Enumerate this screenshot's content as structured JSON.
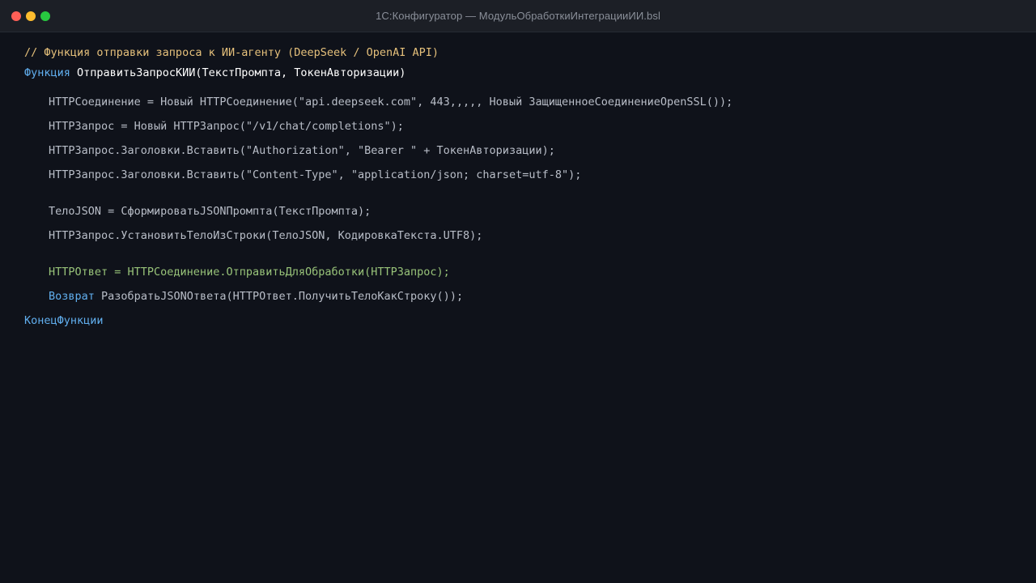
{
  "window": {
    "title": "1С:Конфигуратор — МодульОбработкиИнтеграцииИИ.bsl"
  },
  "colors": {
    "background": "#0f121a",
    "titlebar": "#1c1f26",
    "comment": "#e5c07b",
    "keyword": "#61afef",
    "function_name": "#ffffff",
    "code": "#b9bec8",
    "highlight": "#98c379",
    "close": "#fe5f57",
    "minimize": "#febc2e",
    "zoom": "#28c840"
  },
  "code": {
    "comment": "// Функция отправки запроса к ИИ-агенту (DeepSeek / OpenAI API)",
    "decl_keyword": "Функция",
    "decl_signature": "ОтправитьЗапросКИИ(ТекстПромпта, ТокенАвторизации)",
    "line_connection": "HTTPСоединение = Новый HTTPСоединение(\"api.deepseek.com\", 443,,,,, Новый ЗащищенноеСоединениеOpenSSL());",
    "line_request": "HTTPЗапрос = Новый HTTPЗапрос(\"/v1/chat/completions\");",
    "line_header_auth": "HTTPЗапрос.Заголовки.Вставить(\"Authorization\", \"Bearer \" + ТокенАвторизации);",
    "line_header_content": "HTTPЗапрос.Заголовки.Вставить(\"Content-Type\", \"application/json; charset=utf-8\");",
    "line_body_json": "ТелоJSON = СформироватьJSONПромпта(ТекстПромпта);",
    "line_set_body": "HTTPЗапрос.УстановитьТелоИзСтроки(ТелоJSON, КодировкаТекста.UTF8);",
    "line_response": "HTTPОтвет = HTTPСоединение.ОтправитьДляОбработки(HTTPЗапрос);",
    "return_keyword": "Возврат",
    "return_expr": "РазобратьJSONОтвета(HTTPОтвет.ПолучитьТелоКакСтроку());",
    "end_keyword": "КонецФункции"
  }
}
